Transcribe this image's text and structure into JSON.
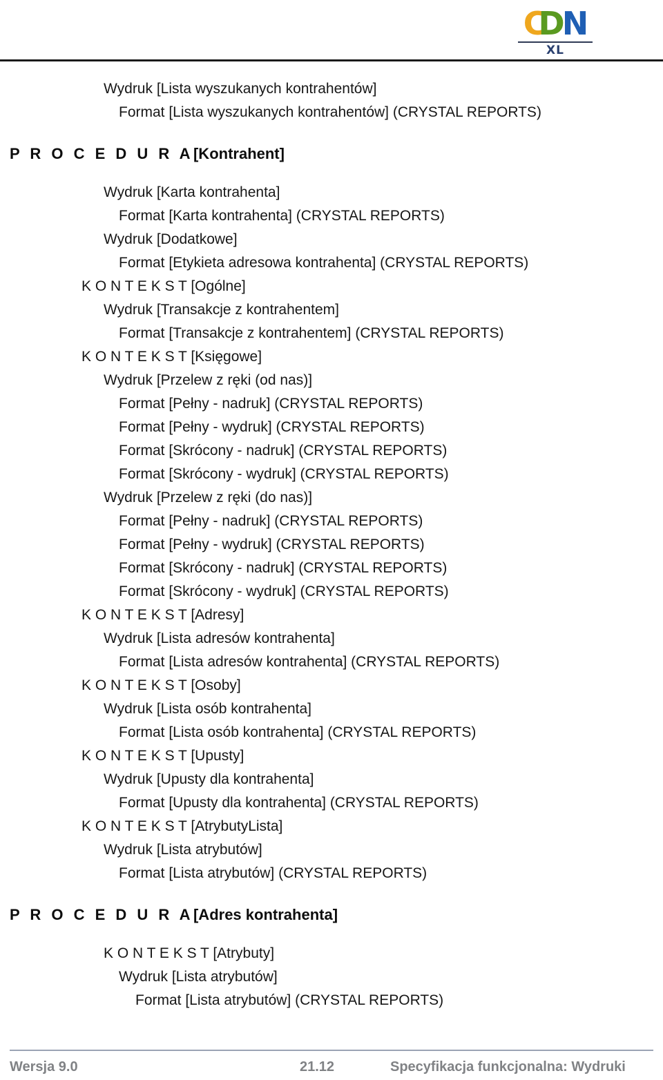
{
  "header": {
    "logo": {
      "letter_c": "C",
      "letter_d": "D",
      "letter_n": "N",
      "subtitle": "XL",
      "color_c": "#efa71e",
      "color_d": "#5a9a20",
      "color_n": "#1f5fb4",
      "color_subtitle": "#2b4170"
    }
  },
  "document": {
    "lines": [
      {
        "id": "l01",
        "level": 2,
        "text": "Wydruk [Lista wyszukanych kontrahentów]"
      },
      {
        "id": "l02",
        "level": 3,
        "text": "Format [Lista wyszukanych kontrahentów] (CRYSTAL REPORTS)"
      },
      {
        "id": "l03",
        "level": 2,
        "text": "Wydruk [Karta kontrahenta]"
      },
      {
        "id": "l04",
        "level": 3,
        "text": "Format [Karta kontrahenta] (CRYSTAL REPORTS)"
      },
      {
        "id": "l05",
        "level": 2,
        "text": "Wydruk [Dodatkowe]"
      },
      {
        "id": "l06",
        "level": 3,
        "text": "Format [Etykieta adresowa kontrahenta] (CRYSTAL REPORTS)"
      },
      {
        "id": "l07",
        "level": 1,
        "text": "K O N T E K S T [Ogólne]"
      },
      {
        "id": "l08",
        "level": 2,
        "text": "Wydruk [Transakcje z kontrahentem]"
      },
      {
        "id": "l09",
        "level": 3,
        "text": "Format [Transakcje z kontrahentem] (CRYSTAL REPORTS)"
      },
      {
        "id": "l10",
        "level": 1,
        "text": "K O N T E K S T [Księgowe]"
      },
      {
        "id": "l11",
        "level": 2,
        "text": "Wydruk [Przelew z ręki (od nas)]"
      },
      {
        "id": "l12",
        "level": 3,
        "text": "Format [Pełny - nadruk] (CRYSTAL REPORTS)"
      },
      {
        "id": "l13",
        "level": 3,
        "text": "Format [Pełny - wydruk] (CRYSTAL REPORTS)"
      },
      {
        "id": "l14",
        "level": 3,
        "text": "Format [Skrócony - nadruk] (CRYSTAL REPORTS)"
      },
      {
        "id": "l15",
        "level": 3,
        "text": "Format [Skrócony - wydruk] (CRYSTAL REPORTS)"
      },
      {
        "id": "l16",
        "level": 2,
        "text": "Wydruk [Przelew z ręki (do nas)]"
      },
      {
        "id": "l17",
        "level": 3,
        "text": "Format [Pełny - nadruk] (CRYSTAL REPORTS)"
      },
      {
        "id": "l18",
        "level": 3,
        "text": "Format [Pełny - wydruk] (CRYSTAL REPORTS)"
      },
      {
        "id": "l19",
        "level": 3,
        "text": "Format [Skrócony - nadruk] (CRYSTAL REPORTS)"
      },
      {
        "id": "l20",
        "level": 3,
        "text": "Format [Skrócony - wydruk] (CRYSTAL REPORTS)"
      },
      {
        "id": "l21",
        "level": 1,
        "text": "K O N T E K S T [Adresy]"
      },
      {
        "id": "l22",
        "level": 2,
        "text": "Wydruk [Lista adresów kontrahenta]"
      },
      {
        "id": "l23",
        "level": 3,
        "text": "Format [Lista adresów kontrahenta] (CRYSTAL REPORTS)"
      },
      {
        "id": "l24",
        "level": 1,
        "text": "K O N T E K S T [Osoby]"
      },
      {
        "id": "l25",
        "level": 2,
        "text": "Wydruk [Lista osób kontrahenta]"
      },
      {
        "id": "l26",
        "level": 3,
        "text": "Format [Lista osób kontrahenta] (CRYSTAL REPORTS)"
      },
      {
        "id": "l27",
        "level": 1,
        "text": "K O N T E K S T [Upusty]"
      },
      {
        "id": "l28",
        "level": 2,
        "text": "Wydruk [Upusty dla kontrahenta]"
      },
      {
        "id": "l29",
        "level": 3,
        "text": "Format [Upusty dla kontrahenta] (CRYSTAL REPORTS)"
      },
      {
        "id": "l30",
        "level": 1,
        "text": "K O N T E K S T [AtrybutyLista]"
      },
      {
        "id": "l31",
        "level": 2,
        "text": "Wydruk [Lista atrybutów]"
      },
      {
        "id": "l32",
        "level": 3,
        "text": "Format [Lista atrybutów] (CRYSTAL REPORTS)"
      },
      {
        "id": "l33",
        "level": 2,
        "text": "K O N T E K S T [Atrybuty]"
      },
      {
        "id": "l34",
        "level": 3,
        "text": "Wydruk [Lista atrybutów]"
      },
      {
        "id": "l35",
        "level": 4,
        "text": "Format [Lista atrybutów] (CRYSTAL REPORTS)"
      }
    ],
    "headings": {
      "procedura_kontrahent": {
        "spaced": "P R O C E D U R A",
        "name": "[Kontrahent]"
      },
      "procedura_adres_kontrahenta": {
        "spaced": "P R O C E D U R A",
        "name": "[Adres kontrahenta]"
      }
    }
  },
  "footer": {
    "version": "Wersja 9.0",
    "page": "21.12",
    "title": "Specyfikacja funkcjonalna: Wydruki",
    "color": "#808285"
  }
}
